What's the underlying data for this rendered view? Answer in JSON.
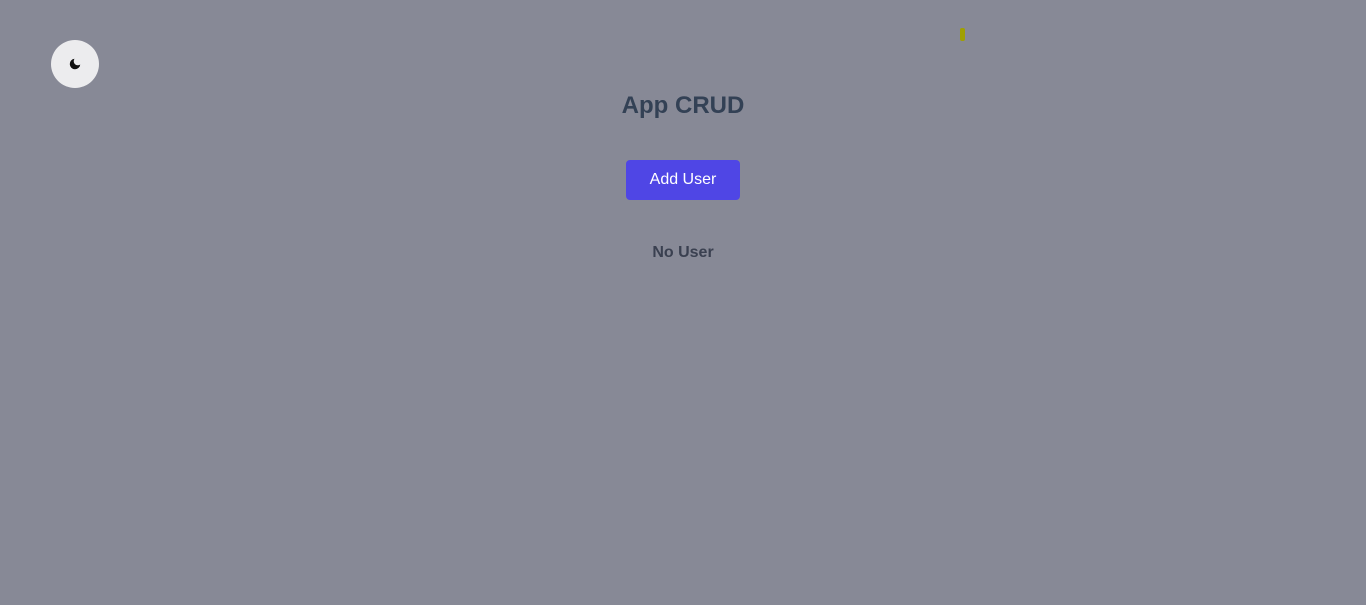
{
  "theme_toggle": {
    "icon": "moon-icon"
  },
  "header": {
    "title": "App CRUD"
  },
  "actions": {
    "add_user_label": "Add User"
  },
  "users": {
    "empty_text": "No User"
  },
  "colors": {
    "background": "#878996",
    "primary_button": "#4f46e5",
    "title_text": "#334155",
    "toggle_bg": "#ececee",
    "marker": "#a0a000"
  }
}
